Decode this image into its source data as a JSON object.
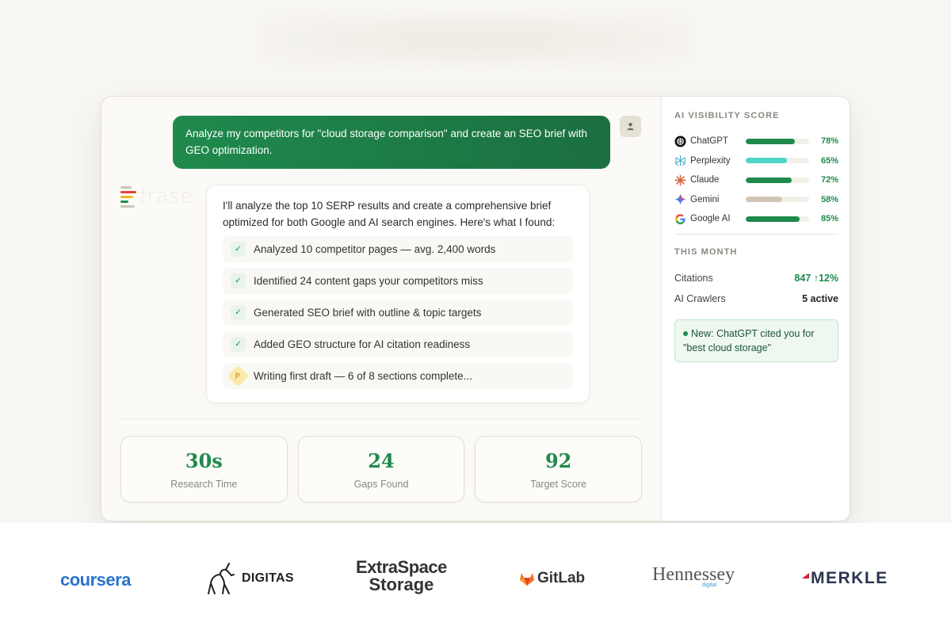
{
  "chat": {
    "user_message": "Analyze my competitors for \"cloud storage comparison\" and create an SEO brief with GEO optimization.",
    "brand_name": "frase",
    "assistant_intro": "I'll analyze the top 10 SERP results and create a comprehensive brief optimized for both Google and AI search engines. Here's what I found:",
    "steps": [
      {
        "label": "Analyzed 10 competitor pages — avg. 2,400 words",
        "status": "done"
      },
      {
        "label": "Identified 24 content gaps your competitors miss",
        "status": "done"
      },
      {
        "label": "Generated SEO brief with outline & topic targets",
        "status": "done"
      },
      {
        "label": "Added GEO structure for AI citation readiness",
        "status": "done"
      },
      {
        "label": "Writing first draft — 6 of 8 sections complete...",
        "status": "in-progress"
      }
    ],
    "check_glyph": "✓",
    "pending_glyph": "P"
  },
  "stats": [
    {
      "value": "30s",
      "label": "Research Time"
    },
    {
      "value": "24",
      "label": "Gaps Found"
    },
    {
      "value": "92",
      "label": "Target Score"
    }
  ],
  "sidebar": {
    "visibility_heading": "AI VISIBILITY SCORE",
    "scores": [
      {
        "name": "ChatGPT",
        "percent": "78%",
        "value": 78,
        "icon": "chatgpt-icon",
        "color": "#1f8a4c"
      },
      {
        "name": "Perplexity",
        "percent": "65%",
        "value": 65,
        "icon": "perplexity-icon",
        "color": "#4fd6c4"
      },
      {
        "name": "Claude",
        "percent": "72%",
        "value": 72,
        "icon": "claude-icon",
        "color": "#1f8a4c"
      },
      {
        "name": "Gemini",
        "percent": "58%",
        "value": 58,
        "icon": "gemini-icon",
        "color": "#d2c5b6"
      },
      {
        "name": "Google AI",
        "percent": "85%",
        "value": 85,
        "icon": "google-icon",
        "color": "#1f8a4c"
      }
    ],
    "month_heading": "THIS MONTH",
    "citations_label": "Citations",
    "citations_value": "847 ↑12%",
    "crawlers_label": "AI Crawlers",
    "crawlers_value": "5 active",
    "notice": "New: ChatGPT cited you for \"best cloud storage\""
  },
  "logos": {
    "coursera": "coursera",
    "digitas": "DIGITAS",
    "extraspace_line1": "ExtraSpace",
    "extraspace_line2": "Storage",
    "gitlab": "GitLab",
    "hennessey": "Hennessey",
    "hennessey_sub": "digital",
    "merkle": "MERKLE"
  },
  "colors": {
    "accent": "#1f8a4c",
    "background": "#f8f6f2"
  }
}
